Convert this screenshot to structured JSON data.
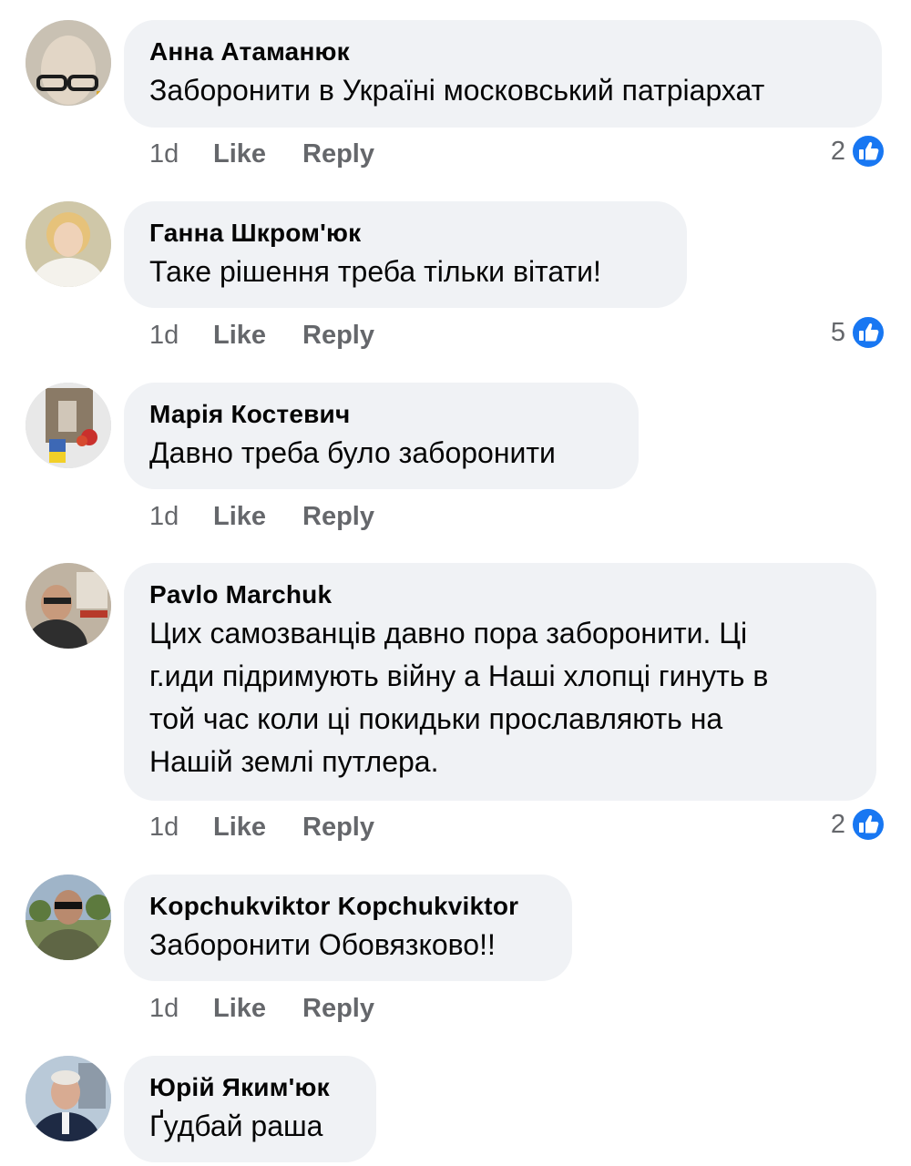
{
  "comments": [
    {
      "author": "Анна Атаманюк",
      "text": [
        "Заборонити в Україні московський патріархат"
      ],
      "time": "1d",
      "like_label": "Like",
      "reply_label": "Reply",
      "reactions": "2"
    },
    {
      "author": "Ганна Шкром'юк",
      "text": [
        "Таке рішення треба тільки вітати!"
      ],
      "time": "1d",
      "like_label": "Like",
      "reply_label": "Reply",
      "reactions": "5"
    },
    {
      "author": "Марія Костевич",
      "text": [
        "Давно треба було заборонити"
      ],
      "time": "1d",
      "like_label": "Like",
      "reply_label": "Reply",
      "reactions": ""
    },
    {
      "author": "Pavlo Marchuk",
      "text": [
        "Цих самозванців давно пора заборонити. Ці",
        "г.иди підримують війну а Наші хлопці гинуть в",
        "той час коли ці покидьки прославляють на",
        "Нашій землі путлера."
      ],
      "time": "1d",
      "like_label": "Like",
      "reply_label": "Reply",
      "reactions": "2"
    },
    {
      "author": "Kopchukviktor Kopchukviktor",
      "text": [
        "Заборонити Обовязково!!"
      ],
      "time": "1d",
      "like_label": "Like",
      "reply_label": "Reply",
      "reactions": ""
    },
    {
      "author": "Юрій Яким'юк",
      "text": [
        "Ґудбай раша"
      ],
      "time": "",
      "like_label": "",
      "reply_label": "",
      "reactions": ""
    }
  ],
  "colors": {
    "bubble": "#f0f2f5",
    "meta": "#65676b",
    "like_blue": "#1877f2"
  },
  "icons": {
    "reaction": "like-thumbs-up-icon"
  }
}
